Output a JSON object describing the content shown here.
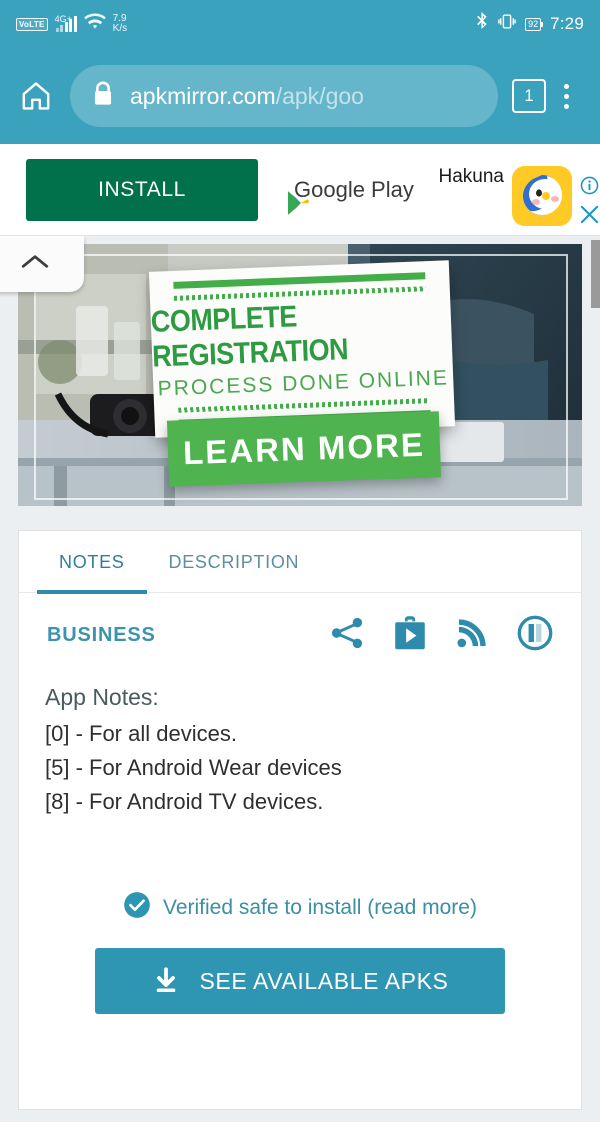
{
  "statusbar": {
    "volte": "VoLTE",
    "network": "4G+",
    "speed_value": "7.9",
    "speed_unit": "K/s",
    "battery": "92",
    "clock": "7:29",
    "bluetooth_icon": "bluetooth-icon",
    "vibrate_icon": "vibrate-icon",
    "wifi_icon": "wifi-icon",
    "signal_icon": "signal-bars-icon"
  },
  "toolbar": {
    "home_icon": "home-icon",
    "lock_icon": "lock-icon",
    "url_host": "apkmirror.com",
    "url_path": "/apk/goo",
    "url_full": "apkmirror.com/apk/goo",
    "tab_count": "1",
    "menu_icon": "overflow-menu-icon"
  },
  "ad": {
    "install_label": "INSTALL",
    "store_label": "Google Play",
    "app_name": "Hakuna",
    "info_icon": "info-icon",
    "close_icon": "close-icon",
    "app_icon": "hakuna-app-icon"
  },
  "hero": {
    "collapse_icon": "chevron-up-icon",
    "line1": "COMPLETE REGISTRATION",
    "line2": "PROCESS DONE ONLINE",
    "cta": "LEARN MORE"
  },
  "tabs": [
    {
      "label": "NOTES",
      "active": true
    },
    {
      "label": "DESCRIPTION",
      "active": false
    }
  ],
  "content": {
    "category": "BUSINESS",
    "social_icons": [
      "share-icon",
      "google-play-store-icon",
      "rss-feed-icon",
      "pocket-icon"
    ],
    "notes_title": "App Notes:",
    "notes": [
      "[0] - For all devices.",
      "[5] - For Android Wear devices",
      "[8] - For Android TV devices."
    ],
    "verified_text": "Verified safe to install (read more)",
    "verified_icon": "check-circle-icon",
    "download_icon": "download-icon",
    "download_label": "SEE AVAILABLE APKS"
  },
  "colors": {
    "toolbar": "#3ba2bd",
    "accent": "#2e96b2",
    "install_green": "#01714b",
    "sign_green": "#43ad49",
    "page_bg": "#eceff1"
  }
}
